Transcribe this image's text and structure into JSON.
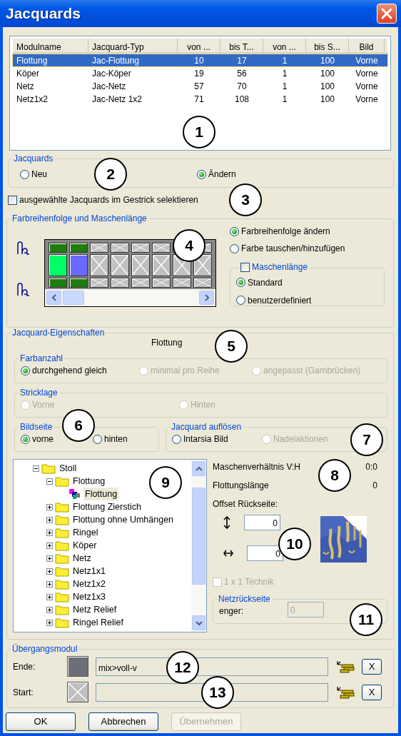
{
  "window": {
    "title": "Jacquards"
  },
  "table": {
    "columns": [
      "Modulname",
      "Jacquard-Typ",
      "von ...",
      "bis T...",
      "von ...",
      "bis S...",
      "Bild"
    ],
    "rows": [
      {
        "cells": [
          "Flottung",
          "Jac-Flottung",
          "10",
          "17",
          "1",
          "100",
          "Vorne"
        ],
        "selected": true
      },
      {
        "cells": [
          "Köper",
          "Jac-Köper",
          "19",
          "56",
          "1",
          "100",
          "Vorne"
        ],
        "selected": false
      },
      {
        "cells": [
          "Netz",
          "Jac-Netz",
          "57",
          "70",
          "1",
          "100",
          "Vorne"
        ],
        "selected": false
      },
      {
        "cells": [
          "Netz1x2",
          "Jac-Netz 1x2",
          "71",
          "108",
          "1",
          "100",
          "Vorne"
        ],
        "selected": false
      }
    ]
  },
  "jacquards_group": {
    "title": "Jacquards",
    "options": [
      {
        "label": "Neu",
        "selected": false
      },
      {
        "label": "Ändern",
        "selected": true
      }
    ]
  },
  "select_in_knit": {
    "label": "ausgewählte Jacquards im Gestrick selektieren",
    "checked": false
  },
  "color_group": {
    "title": "Farbreihenfolge und Maschenlänge",
    "grid": {
      "rows": [
        {
          "cells": [
            {
              "kind": "color",
              "color": "#1e7d0c"
            },
            {
              "kind": "color",
              "color": "#1e7d0c"
            },
            {
              "kind": "empty"
            },
            {
              "kind": "empty"
            },
            {
              "kind": "empty"
            },
            {
              "kind": "empty"
            },
            {
              "kind": "empty"
            },
            {
              "kind": "empty"
            }
          ]
        },
        {
          "cells": [
            {
              "kind": "color",
              "color": "#00ff66"
            },
            {
              "kind": "color",
              "color": "#6a6aff"
            },
            {
              "kind": "empty"
            },
            {
              "kind": "empty"
            },
            {
              "kind": "empty"
            },
            {
              "kind": "empty"
            },
            {
              "kind": "empty"
            },
            {
              "kind": "empty"
            }
          ]
        },
        {
          "cells": [
            {
              "kind": "color",
              "color": "#1e7d0c"
            },
            {
              "kind": "color",
              "color": "#1e7d0c"
            },
            {
              "kind": "empty"
            },
            {
              "kind": "empty"
            },
            {
              "kind": "empty"
            },
            {
              "kind": "empty"
            },
            {
              "kind": "empty"
            },
            {
              "kind": "empty"
            }
          ]
        }
      ]
    },
    "mode_options": [
      {
        "label": "Farbreihenfolge ändern",
        "selected": true
      },
      {
        "label": "Farbe tauschen/hinzufügen",
        "selected": false
      }
    ],
    "stitch_length": {
      "label": "Maschenlänge",
      "checked": false,
      "options": [
        {
          "label": "Standard",
          "selected": true
        },
        {
          "label": "benutzerdefiniert",
          "selected": false
        }
      ]
    }
  },
  "properties": {
    "title": "Jacquard-Eigenschaften",
    "module": "Flottung",
    "color_count": {
      "title": "Farbanzahl",
      "options": [
        {
          "label": "durchgehend gleich",
          "selected": true,
          "disabled": false
        },
        {
          "label": "minimal pro Reihe",
          "selected": false,
          "disabled": true
        },
        {
          "label": "angepasst (Garnbrücken)",
          "selected": false,
          "disabled": true
        }
      ]
    },
    "knit_position": {
      "title": "Stricklage",
      "options": [
        {
          "label": "Vorne",
          "selected": false,
          "disabled": true
        },
        {
          "label": "Hinten",
          "selected": false,
          "disabled": true
        }
      ]
    },
    "image_side": {
      "title": "Bildseite",
      "options": [
        {
          "label": "vorne",
          "selected": true,
          "disabled": false
        },
        {
          "label": "hinten",
          "selected": false,
          "disabled": false
        }
      ]
    },
    "resolve": {
      "title": "Jacquard auflösen",
      "options": [
        {
          "label": "Intarsia Bild",
          "selected": false,
          "disabled": false
        },
        {
          "label": "Nadelaktionen",
          "selected": false,
          "disabled": true
        }
      ]
    },
    "tree": {
      "items": [
        {
          "label": "Stoll",
          "kind": "folder",
          "expanded": true,
          "selected": false,
          "children": [
            {
              "label": "Flottung",
              "kind": "folder",
              "expanded": true,
              "selected": false,
              "children": [
                {
                  "label": "Flottung",
                  "kind": "module",
                  "selected": true
                }
              ]
            },
            {
              "label": "Flottung Zierstich",
              "kind": "folder",
              "expanded": false,
              "selected": false
            },
            {
              "label": "Flottung ohne Umhängen",
              "kind": "folder",
              "expanded": false,
              "selected": false
            },
            {
              "label": "Ringel",
              "kind": "folder",
              "expanded": false,
              "selected": false
            },
            {
              "label": "Köper",
              "kind": "folder",
              "expanded": false,
              "selected": false
            },
            {
              "label": "Netz",
              "kind": "folder",
              "expanded": false,
              "selected": false
            },
            {
              "label": "Netz1x1",
              "kind": "folder",
              "expanded": false,
              "selected": false
            },
            {
              "label": "Netz1x2",
              "kind": "folder",
              "expanded": false,
              "selected": false
            },
            {
              "label": "Netz1x3",
              "kind": "folder",
              "expanded": false,
              "selected": false
            },
            {
              "label": "Netz Relief",
              "kind": "folder",
              "expanded": false,
              "selected": false
            },
            {
              "label": "Ringel Relief",
              "kind": "folder",
              "expanded": false,
              "selected": false
            }
          ]
        }
      ]
    },
    "ratio": {
      "label": "Maschenverhältnis V:H",
      "value": "0:0"
    },
    "float_length": {
      "label": "Flottungslänge",
      "value": "0"
    },
    "offset": {
      "label": "Offset Rückseite:",
      "vertical": "0",
      "horizontal": "0"
    },
    "technique": {
      "label": "1 x 1 Technik",
      "checked": false,
      "disabled": true
    },
    "net_back": {
      "title": "Netzrückseite",
      "label": "enger:",
      "value": "0",
      "disabled": true
    }
  },
  "transition": {
    "title": "Übergangsmodul",
    "rows": [
      {
        "label": "Ende:",
        "swatch": {
          "kind": "color",
          "color": "#6e6e78"
        },
        "value": "mix>voll-v",
        "clear": "X"
      },
      {
        "label": "Start:",
        "swatch": {
          "kind": "empty"
        },
        "clear": "X"
      }
    ]
  },
  "buttons": [
    {
      "label": "OK",
      "disabled": false
    },
    {
      "label": "Abbrechen",
      "disabled": false
    },
    {
      "label": "Übernehmen",
      "disabled": true
    }
  ],
  "callouts": [
    "1",
    "2",
    "3",
    "4",
    "5",
    "6",
    "7",
    "8",
    "9",
    "10",
    "11",
    "12",
    "13"
  ]
}
